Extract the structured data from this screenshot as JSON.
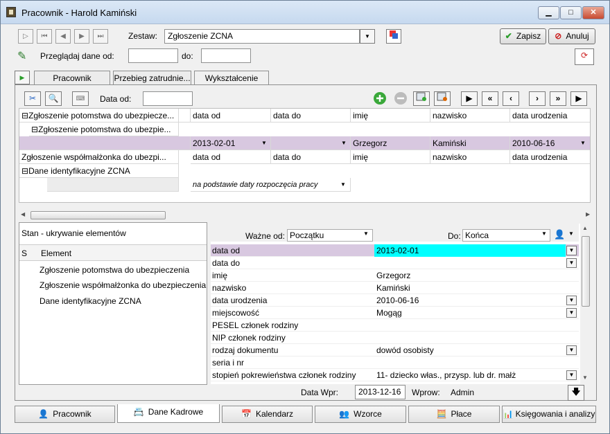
{
  "window": {
    "title": "Pracownik - Harold Kamiński",
    "min": "▁",
    "max": "□",
    "close": "✕"
  },
  "toolbar": {
    "zestaw_label": "Zestaw:",
    "zestaw_value": "Zgłoszenie ZCNA",
    "save": "Zapisz",
    "cancel": "Anuluj",
    "przegladaj_label": "Przeglądaj dane od:",
    "do_label": "do:",
    "nav": [
      "▷",
      "⏮",
      "◀",
      "▶",
      "⏭"
    ]
  },
  "tabs": [
    {
      "label": "Pracownik"
    },
    {
      "label": "Przebieg zatrudnie..."
    },
    {
      "label": "Wykształcenie"
    }
  ],
  "panel": {
    "data_od_label": "Data od:"
  },
  "grid": {
    "tree": [
      {
        "label": "Zgłoszenie potomstwa do ubezpiecze...",
        "prefix": "⊟"
      },
      {
        "label": "Zgłoszenie potomstwa do ubezpie...",
        "prefix": "⊟"
      },
      {
        "label": "",
        "prefix": ""
      },
      {
        "label": "Zgłoszenie współmałżonka do ubezpi...",
        "prefix": ""
      },
      {
        "label": "Dane identyfikacyjne ZCNA",
        "prefix": "⊟"
      },
      {
        "label": "",
        "prefix": ""
      }
    ],
    "header1": [
      "data od",
      "data do",
      "imię",
      "nazwisko",
      "data urodzenia"
    ],
    "datarow": [
      "2013-02-01",
      "",
      "Grzegorz",
      "Kamiński",
      "2010-06-16"
    ],
    "header2": [
      "data od",
      "data do",
      "imię",
      "nazwisko",
      "data urodzenia"
    ],
    "note": "na podstawie daty rozpoczęcia pracy"
  },
  "left": {
    "title": "Stan - ukrywanie elementów",
    "col_s": "S",
    "col_element": "Element",
    "items": [
      "Zgłoszenie potomstwa do ubezpieczenia",
      "Zgłoszenie współmałżonka do ubezpieczenia",
      "Dane identyfikacyjne ZCNA"
    ]
  },
  "right": {
    "wazne_label": "Ważne od:",
    "wazne_value": "Początku",
    "do_label": "Do:",
    "do_value": "Końca",
    "rows": [
      {
        "name": "data od",
        "value": "2013-02-01",
        "dd": true
      },
      {
        "name": "data do",
        "value": "",
        "dd": true
      },
      {
        "name": "imię",
        "value": "Grzegorz",
        "dd": false
      },
      {
        "name": "nazwisko",
        "value": "Kamiński",
        "dd": false
      },
      {
        "name": "data urodzenia",
        "value": "2010-06-16",
        "dd": true
      },
      {
        "name": "miejscowość",
        "value": "Mogąg",
        "dd": true
      },
      {
        "name": "PESEL członek rodziny",
        "value": "",
        "dd": false
      },
      {
        "name": "NIP członek rodziny",
        "value": "",
        "dd": false
      },
      {
        "name": "rodzaj dokumentu",
        "value": "dowód osobisty",
        "dd": true
      },
      {
        "name": "seria i nr",
        "value": "",
        "dd": false
      },
      {
        "name": "stopień pokrewieństwa członek rodziny",
        "value": "11- dziecko włas., przysp. lub dr. małż",
        "dd": true
      }
    ]
  },
  "status": {
    "data_wpr_label": "Data Wpr:",
    "data_wpr_value": "2013-12-16",
    "wprow_label": "Wprow:",
    "wprow_value": "Admin"
  },
  "bottom_tabs": [
    "Pracownik",
    "Dane Kadrowe",
    "Kalendarz",
    "Wzorce",
    "Płace",
    "Księgowania i analizy"
  ],
  "colors": {
    "selected_row": "#d8c8e0",
    "highlight": "#00ffff"
  }
}
